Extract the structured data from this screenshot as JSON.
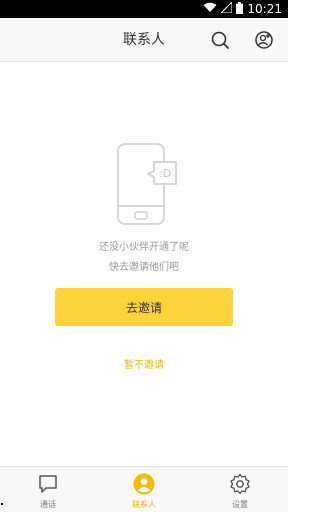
{
  "status_bar": {
    "time": "10:21",
    "icons": [
      "wifi-icon",
      "signal-icon",
      "battery-icon"
    ]
  },
  "header": {
    "title": "联系人",
    "search_icon": "search-icon",
    "add_contact_icon": "add-contact-icon"
  },
  "empty_state": {
    "illustration_icon": "phone-chat-icon",
    "bubble_text": ":D",
    "line1": "还没小伙伴开通了呢",
    "line2": "快去邀请他们吧"
  },
  "actions": {
    "invite_label": "去邀请",
    "skip_label": "暂不邀请"
  },
  "tabs": [
    {
      "label": "通话",
      "icon": "chat-bubble-icon",
      "active": false
    },
    {
      "label": "联系人",
      "icon": "person-icon",
      "active": true
    },
    {
      "label": "设置",
      "icon": "gear-icon",
      "active": false
    }
  ],
  "colors": {
    "accent": "#fbd33b",
    "accent_text": "#e9b600",
    "muted_text": "#9a9a9a"
  }
}
